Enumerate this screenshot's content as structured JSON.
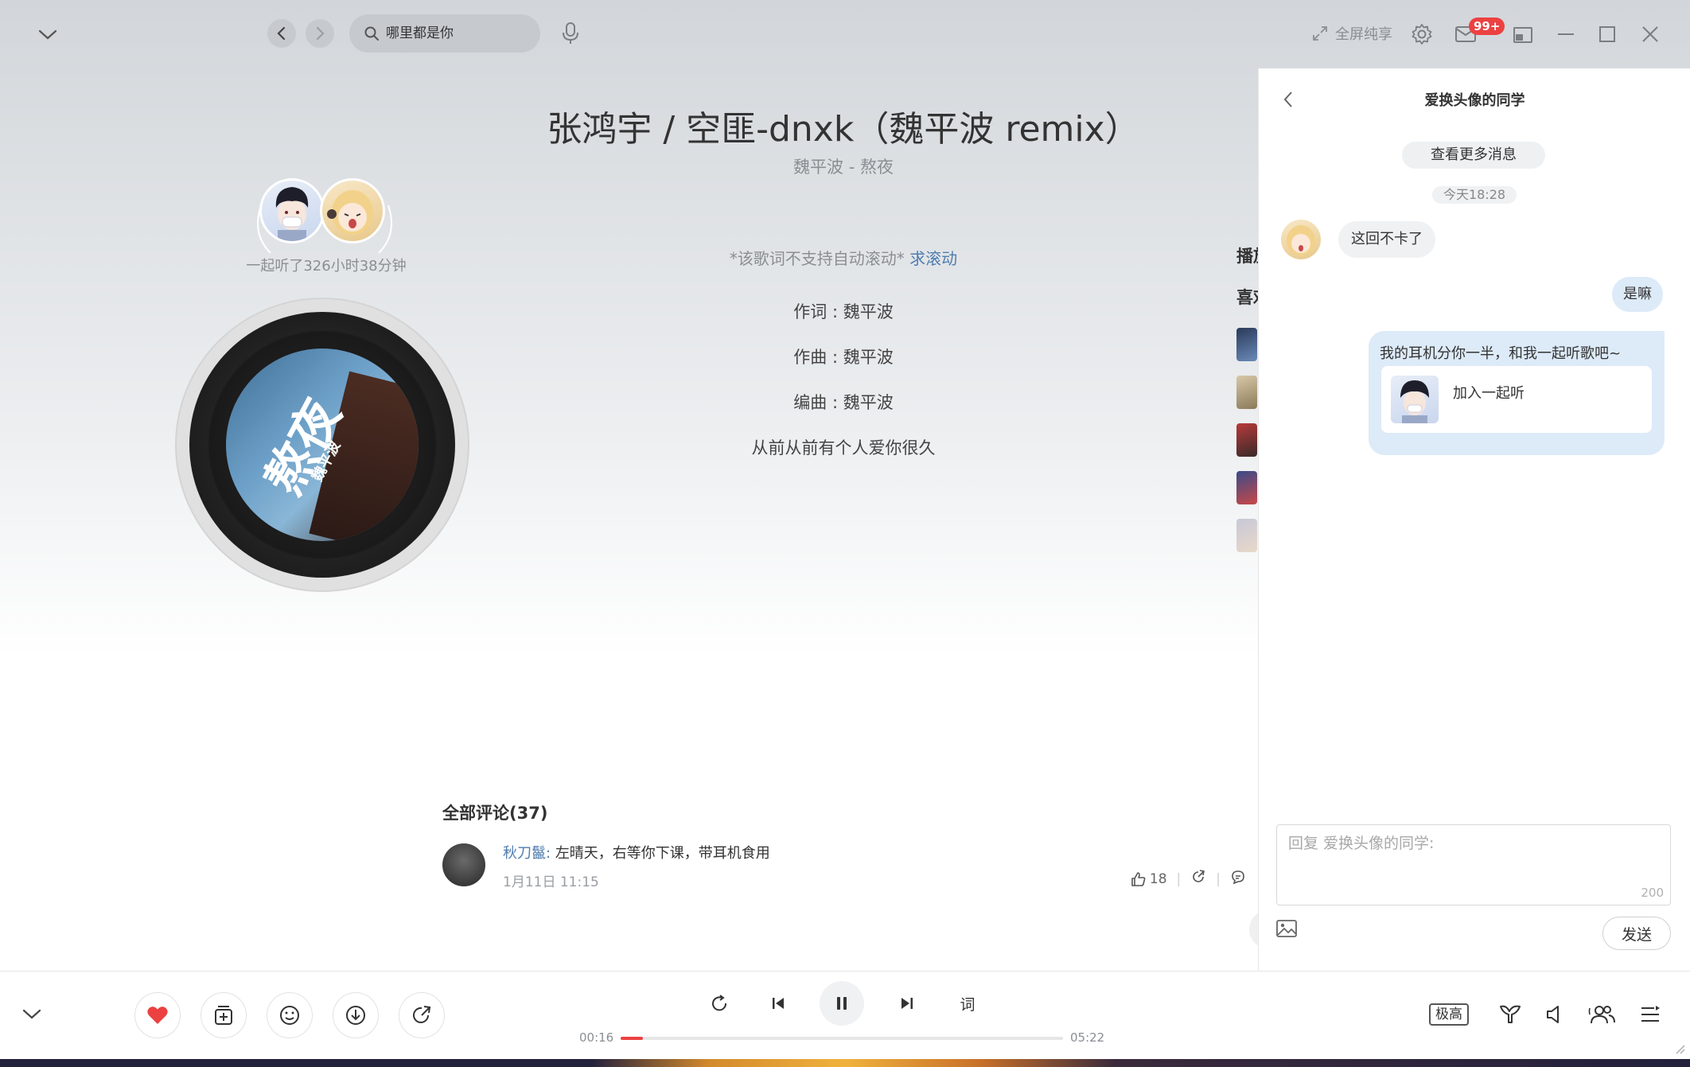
{
  "topbar": {
    "search_placeholder": "哪里都是你",
    "fullscreen_label": "全屏纯享",
    "mail_badge": "99+"
  },
  "song": {
    "title": "张鸿宇 / 空匪-dnxk（魏平波 remix）",
    "subtitle": "魏平波 - 熬夜",
    "album_art_title": "熬夜",
    "album_art_artist": "魏平波"
  },
  "listen_together": {
    "duration_text": "一起听了326小时38分钟"
  },
  "lyrics": {
    "note": "*该歌词不支持自动滚动*",
    "note_link": "求滚动",
    "lines": [
      "作词 : 魏平波",
      "作曲 : 魏平波",
      "编曲 : 魏平波",
      "从前从前有个人爱你很久"
    ]
  },
  "side_peek": {
    "label_1": "播放",
    "label_2": "喜欢"
  },
  "comments": {
    "title": "全部评论(37)",
    "items": [
      {
        "user": "秋刀鬣:",
        "text": "左晴天，右等你下课，带耳机食用",
        "time": "1月11日 11:15",
        "likes": "18"
      }
    ]
  },
  "chat": {
    "title": "爱换头像的同学",
    "more_button": "查看更多消息",
    "time": "今天18:28",
    "messages": [
      {
        "side": "left",
        "text": "这回不卡了"
      },
      {
        "side": "right",
        "text": "是嘛"
      },
      {
        "side": "right",
        "text": "我的耳机分你一半，和我一起听歌吧~",
        "card_label": "加入一起听"
      }
    ],
    "reply_placeholder": "回复 爱换头像的同学:",
    "reply_count": "200",
    "send_label": "发送"
  },
  "player": {
    "current_time": "00:16",
    "total_time": "05:22",
    "progress": 0.05,
    "lyric_button": "词",
    "quality": "极高",
    "liked": true
  },
  "colors": {
    "accent": "#ec4141",
    "link": "#507daf",
    "bubble_right": "#ddeaf8"
  }
}
